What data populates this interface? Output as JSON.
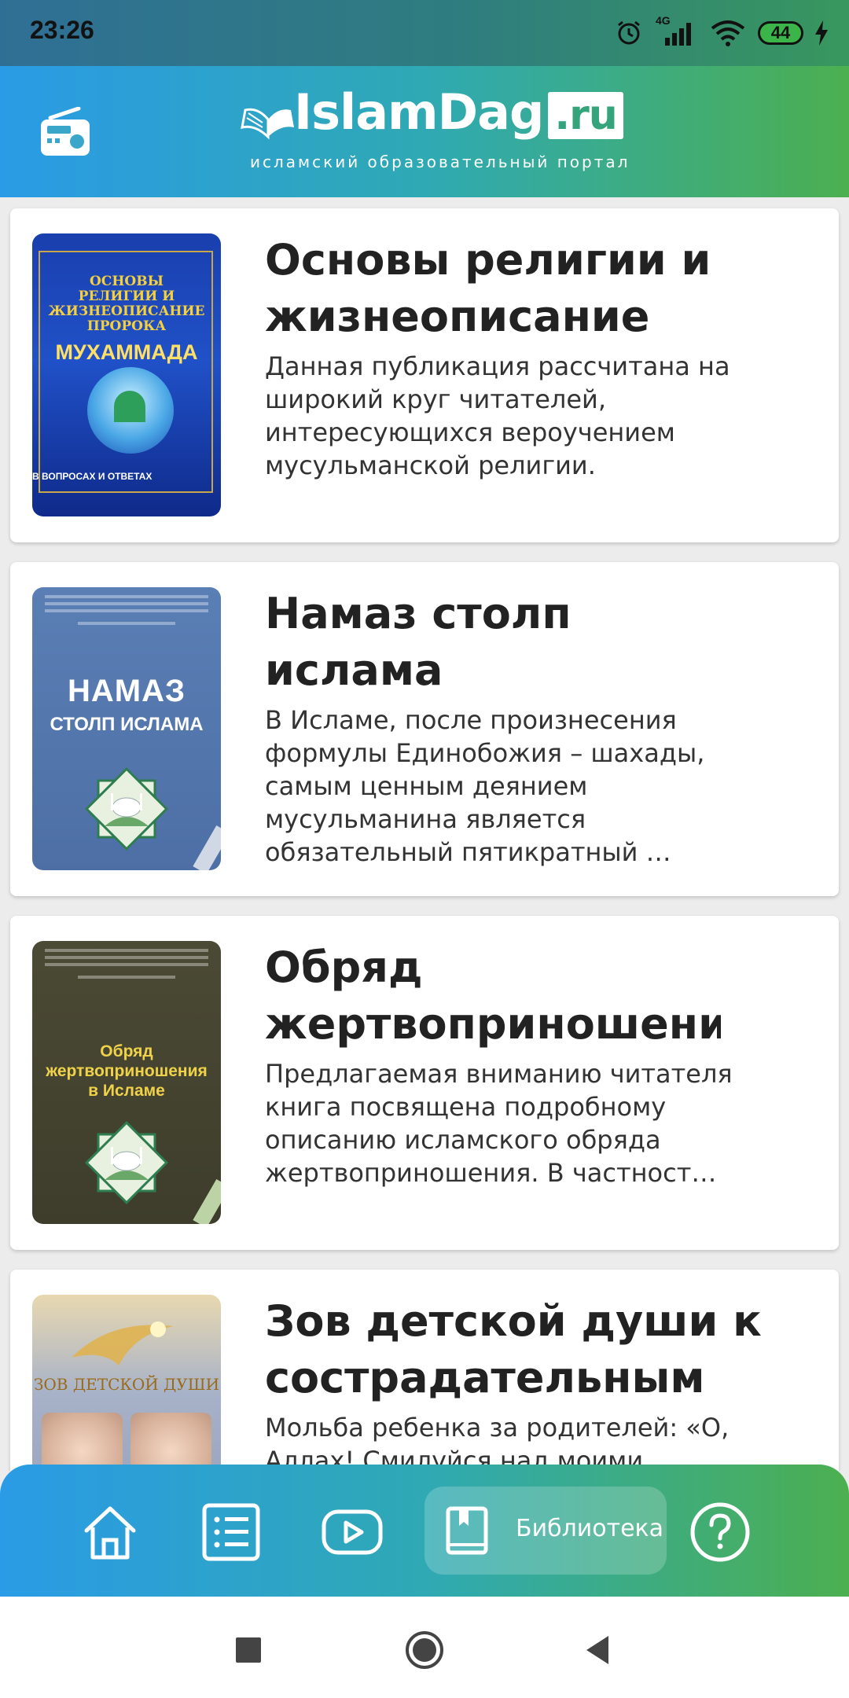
{
  "status_bar": {
    "time": "23:26",
    "network": "4G",
    "battery": "44"
  },
  "header": {
    "logo_name": "IslamDag",
    "logo_tld": ".ru",
    "logo_tagline": "исламский образовательный портал"
  },
  "books": [
    {
      "title": "Основы религии и жизнеописание",
      "description": "Данная публикация рассчитана на широкий круг читателей, интересующихся вероучением мусульманской религии.",
      "cover": {
        "line1": "ОСНОВЫ РЕЛИГИИ И ЖИЗНЕОПИСАНИЕ ПРОРОКА",
        "line2": "МУХАММАДА",
        "line3": "В ВОПРОСАХ И ОТВЕТАХ"
      }
    },
    {
      "title": "Намаз столп ислама",
      "description": "В Исламе, после произнесения формулы Единобожия – шахады, самым ценным деянием мусульманина является обязательный пятикратный …",
      "cover": {
        "line1": "НАМАЗ",
        "line2": "СТОЛП ИСЛАМА"
      }
    },
    {
      "title": "Обряд жертвоприношени",
      "description": "Предлагаемая вниманию читателя книга посвящена подробному описанию исламского обряда жертвоприношения. В частност…",
      "cover": {
        "line1": "Обряд жертвоприношения в Исламе"
      }
    },
    {
      "title": "Зов детской души к сострадательным",
      "description": "Мольба ребенка за родителей: «О, Аллах! Смилуйся над моими",
      "cover": {
        "line1": "ЗОВ ДЕТСКОЙ ДУШИ"
      }
    }
  ],
  "bottom_nav": {
    "active_label": "Библиотека",
    "items": [
      "home",
      "list",
      "video",
      "library",
      "help"
    ]
  },
  "colors": {
    "header_gradient_start": "#2a9be6",
    "header_gradient_end": "#4caf50",
    "card_background": "#ffffff",
    "page_background": "#ececec"
  }
}
